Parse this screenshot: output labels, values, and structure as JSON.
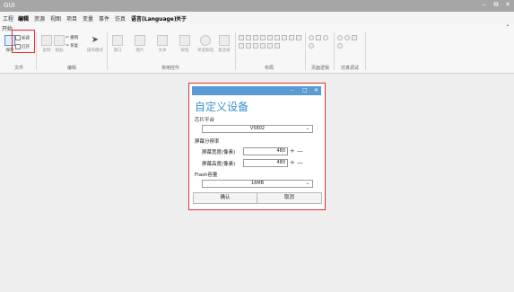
{
  "window": {
    "title": "GUI",
    "minimize": "‒",
    "restore": "⧉",
    "close": "✕"
  },
  "menu": [
    "工程",
    "编辑",
    "资源",
    "视图",
    "项目",
    "变量",
    "事件",
    "仿真",
    "语言(Language)",
    "关于"
  ],
  "ribbon": {
    "tab": "开始",
    "collapse": "ˆ",
    "file": {
      "new": "新建",
      "open": "打开",
      "save": "保存",
      "group": "文件"
    },
    "edit": {
      "copy": "复制",
      "paste": "粘贴",
      "undo": "撤销",
      "redo": "恢复",
      "op_mode": "操作模式",
      "group": "编辑"
    },
    "controls": {
      "items": [
        "窗口",
        "图片",
        "文本",
        "按钮",
        "单选按钮",
        "复选按"
      ],
      "group": "常用控件"
    },
    "layout": {
      "group": "布局"
    },
    "page_logic": {
      "group": "页面逻辑"
    },
    "sim": {
      "group": "仿真调试"
    }
  },
  "dialog": {
    "minimize": "–",
    "maximize": "□",
    "close": "✕",
    "heading": "自定义设备",
    "chip_label": "芯片平台",
    "chip_value": "V5802",
    "resolution_label": "屏幕分辨率",
    "width_label": "屏幕宽度(像素)",
    "width_value": "480",
    "height_label": "屏幕高度(像素)",
    "height_value": "480",
    "flash_label": "Flash容量",
    "flash_value": "16MB",
    "plus": "+",
    "minus": "—",
    "confirm": "确认",
    "cancel": "取消"
  },
  "colors": {
    "accent": "#5b9bd5",
    "highlight": "#e03030",
    "titlebar": "#a6a6a6"
  }
}
